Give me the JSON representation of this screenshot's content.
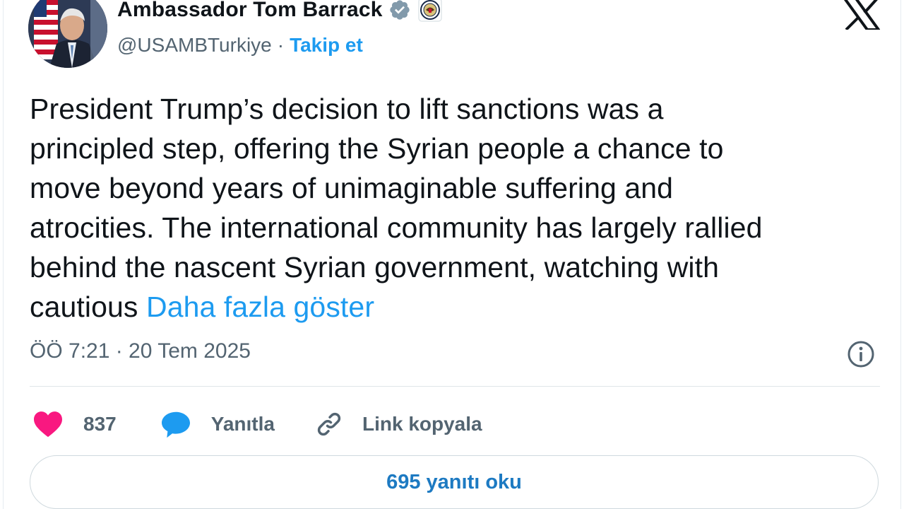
{
  "author": {
    "name": "Ambassador Tom Barrack",
    "handle": "@USAMBTurkiye",
    "separator": "·",
    "follow_label": "Takip et"
  },
  "icons": {
    "verified": "verified-badge-icon",
    "affiliation": "us-state-department-seal-icon",
    "platform": "x-logo-icon",
    "info": "info-icon",
    "like": "heart-icon",
    "reply": "speech-bubble-icon",
    "copy": "link-icon"
  },
  "tweet": {
    "lines": [
      "President Trump’s decision to lift sanctions was a",
      "principled step, offering the Syrian people a chance to",
      "move beyond years of unimaginable suffering and",
      "atrocities. The international community has largely rallied",
      "behind the nascent Syrian government, watching with",
      "cautious"
    ],
    "show_more_label": "Daha fazla göster",
    "timestamp": "ÖÖ 7:21 · 20 Tem 2025"
  },
  "actions": {
    "like_count": "837",
    "reply_label": "Yanıtla",
    "copy_link_label": "Link kopyala"
  },
  "replies_button_label": "695 yanıtı oku",
  "colors": {
    "accent": "#1d9bf0",
    "like": "#f91880",
    "reply_icon": "#1d9bf0",
    "muted_text": "#536471",
    "verified_badge": "#829aab"
  }
}
